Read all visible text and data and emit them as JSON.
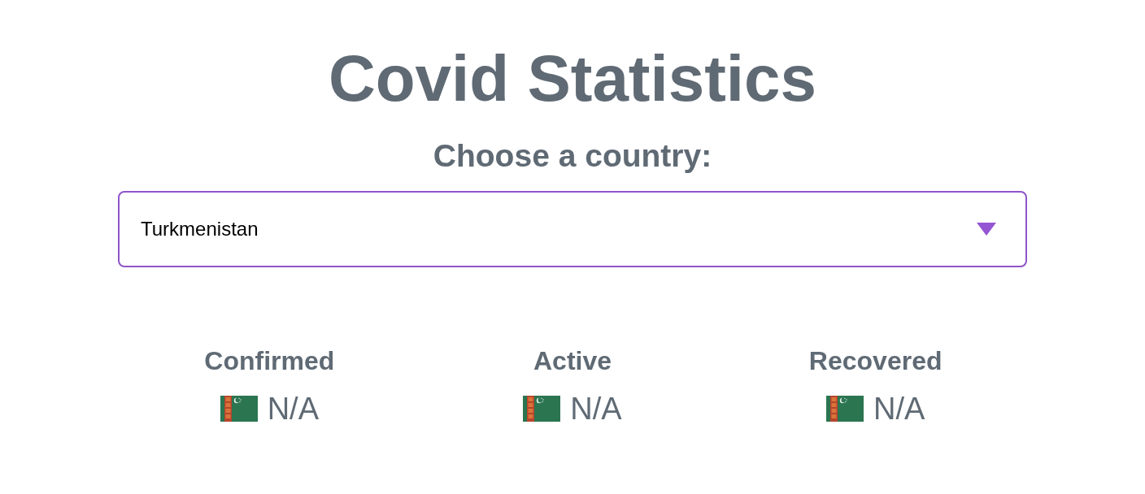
{
  "header": {
    "title": "Covid Statistics",
    "subtitle": "Choose a country:"
  },
  "country_select": {
    "value": "Turkmenistan"
  },
  "stats": [
    {
      "label": "Confirmed",
      "value": "N/A"
    },
    {
      "label": "Active",
      "value": "N/A"
    },
    {
      "label": "Recovered",
      "value": "N/A"
    }
  ]
}
